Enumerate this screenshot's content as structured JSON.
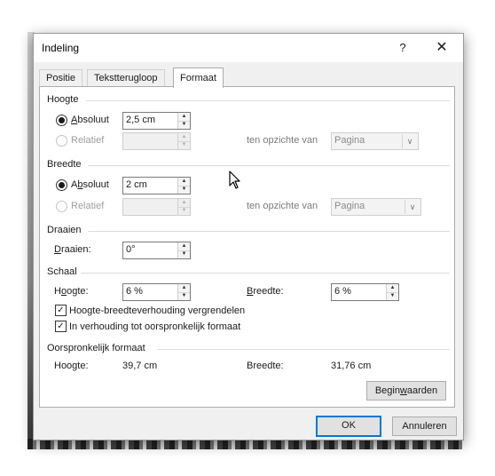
{
  "dialog": {
    "title": "Indeling",
    "help": "?",
    "close": "✕"
  },
  "tabs": [
    {
      "label": "Positie",
      "active": false
    },
    {
      "label": "Tekstterugloop",
      "active": false
    },
    {
      "label": "Formaat",
      "active": true
    }
  ],
  "height": {
    "section": "Hoogte",
    "absolute_label": "Absoluut",
    "absolute_value": "2,5 cm",
    "relative_label": "Relatief",
    "relative_value": "",
    "relative_to_label": "ten opzichte van",
    "relative_to_value": "Pagina"
  },
  "width": {
    "section": "Breedte",
    "absolute_label": "Absoluut",
    "absolute_value": "2 cm",
    "relative_label": "Relatief",
    "relative_value": "",
    "relative_to_label": "ten opzichte van",
    "relative_to_value": "Pagina"
  },
  "rotate": {
    "section": "Draaien",
    "label": "Draaien:",
    "value": "0°"
  },
  "scale": {
    "section": "Schaal",
    "height_label": "Hoogte:",
    "height_value": "6 %",
    "width_label": "Breedte:",
    "width_value": "6 %",
    "lock_aspect_label": "Hoogte-breedteverhouding vergrendelen",
    "lock_aspect_checked": true,
    "relative_original_label": "In verhouding tot oorspronkelijk formaat",
    "relative_original_checked": true
  },
  "original": {
    "section": "Oorspronkelijk formaat",
    "height_label": "Hoogte:",
    "height_value": "39,7 cm",
    "width_label": "Breedte:",
    "width_value": "31,76 cm",
    "reset_label": "Beginwaarden"
  },
  "footer": {
    "ok_label": "OK",
    "cancel_label": "Annuleren"
  },
  "icons": {
    "radio_checked": "radio-checked",
    "checkbox_checked": "✓",
    "spin_up": "▲",
    "spin_down": "▼",
    "dropdown": "chevron-down"
  }
}
